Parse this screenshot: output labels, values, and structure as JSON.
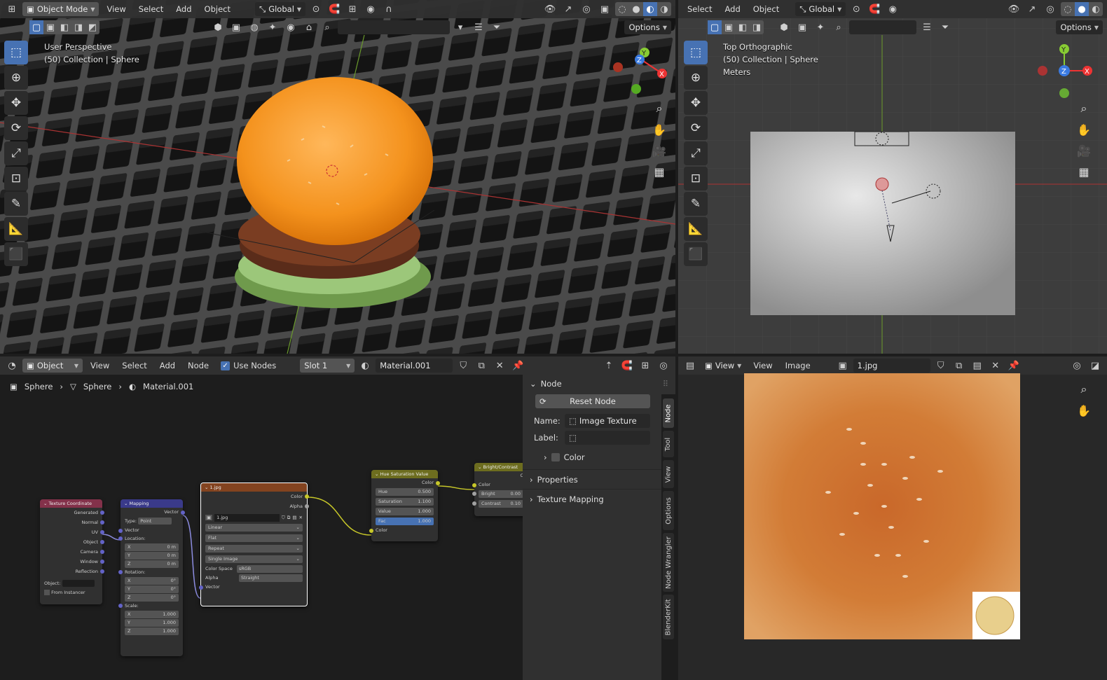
{
  "vp_left": {
    "mode": "Object Mode",
    "menus": [
      "View",
      "Select",
      "Add",
      "Object"
    ],
    "transform": "Global",
    "options": "Options",
    "view_name": "User Perspective",
    "collection": "(50) Collection | Sphere",
    "gizmo": {
      "x": "X",
      "y": "Y",
      "z": "Z"
    }
  },
  "vp_right": {
    "menus": [
      "Select",
      "Add",
      "Object"
    ],
    "transform": "Global",
    "options": "Options",
    "view_name": "Top Orthographic",
    "collection": "(50) Collection | Sphere",
    "units": "Meters",
    "gizmo": {
      "x": "X",
      "y": "Y",
      "z": "Z"
    }
  },
  "node_editor": {
    "type": "Object",
    "menus": [
      "View",
      "Select",
      "Add",
      "Node"
    ],
    "use_nodes": "Use Nodes",
    "slot": "Slot 1",
    "material": "Material.001",
    "breadcrumb": [
      "Sphere",
      "Sphere",
      "Material.001"
    ],
    "nodes": {
      "texcoord": {
        "title": "Texture Coordinate",
        "outputs": [
          "Generated",
          "Normal",
          "UV",
          "Object",
          "Camera",
          "Window",
          "Reflection"
        ],
        "object_label": "Object:",
        "from_instancer": "From Instancer"
      },
      "mapping": {
        "title": "Mapping",
        "out": "Vector",
        "type_label": "Type:",
        "type_value": "Point",
        "vector": "Vector",
        "location": "Location:",
        "loc": [
          [
            "X",
            "0 m"
          ],
          [
            "Y",
            "0 m"
          ],
          [
            "Z",
            "0 m"
          ]
        ],
        "rotation": "Rotation:",
        "rot": [
          [
            "X",
            "0°"
          ],
          [
            "Y",
            "0°"
          ],
          [
            "Z",
            "0°"
          ]
        ],
        "scale": "Scale:",
        "scl": [
          [
            "X",
            "1.000"
          ],
          [
            "Y",
            "1.000"
          ],
          [
            "Z",
            "1.000"
          ]
        ]
      },
      "image": {
        "title": "1.jpg",
        "outputs": [
          "Color",
          "Alpha"
        ],
        "image_name": "1.jpg",
        "interp": "Linear",
        "proj": "Flat",
        "ext": "Repeat",
        "source": "Single Image",
        "cs_label": "Color Space",
        "cs_value": "sRGB",
        "alpha_label": "Alpha",
        "alpha_value": "Straight",
        "vector": "Vector"
      },
      "hsv": {
        "title": "Hue Saturation Value",
        "out": "Color",
        "fields": [
          [
            "Hue",
            "0.500"
          ],
          [
            "Saturation",
            "1.100"
          ],
          [
            "Value",
            "1.000"
          ],
          [
            "Fac",
            "1.000"
          ]
        ],
        "color": "Color"
      },
      "bc": {
        "title": "Bright/Contrast",
        "out": "C",
        "color": "Color",
        "fields": [
          [
            "Bright",
            "0.00"
          ],
          [
            "Contrast",
            "0.10"
          ]
        ]
      }
    }
  },
  "side_panel": {
    "node_header": "Node",
    "reset": "Reset Node",
    "name_label": "Name:",
    "name_value": "Image Texture",
    "label_label": "Label:",
    "color": "Color",
    "properties": "Properties",
    "texture_mapping": "Texture Mapping",
    "tabs": [
      "Node",
      "Tool",
      "View",
      "Options",
      "Node Wrangler",
      "BlenderKit"
    ]
  },
  "image_editor": {
    "view_mode": "View",
    "menus": [
      "View",
      "Image"
    ],
    "image_name": "1.jpg"
  }
}
